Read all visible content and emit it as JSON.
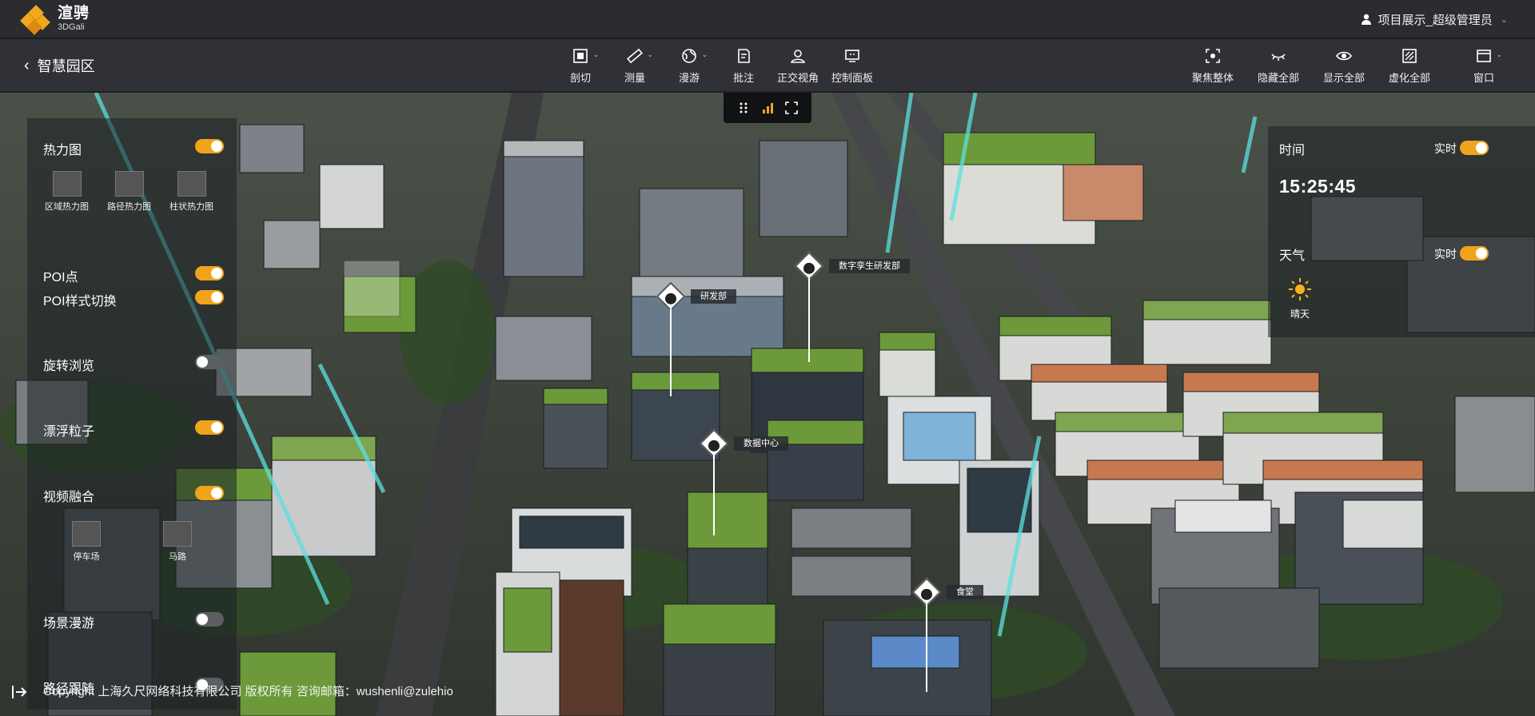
{
  "app": {
    "name": "渲骋",
    "sub": "3DGali"
  },
  "user": {
    "label": "项目展示_超级管理员"
  },
  "page": {
    "title": "智慧园区"
  },
  "tools": [
    {
      "id": "cut",
      "label": "剖切",
      "icon": "section-cut-icon",
      "dropdown": true
    },
    {
      "id": "measure",
      "label": "测量",
      "icon": "ruler-icon",
      "dropdown": true
    },
    {
      "id": "roam",
      "label": "漫游",
      "icon": "globe-icon",
      "dropdown": true
    },
    {
      "id": "annotate",
      "label": "批注",
      "icon": "annotate-icon",
      "dropdown": false
    },
    {
      "id": "ortho",
      "label": "正交视角",
      "icon": "ortho-view-icon",
      "dropdown": false
    },
    {
      "id": "panel",
      "label": "控制面板",
      "icon": "control-panel-icon",
      "dropdown": false
    }
  ],
  "right_tools": [
    {
      "id": "focus",
      "label": "聚焦整体",
      "icon": "focus-icon"
    },
    {
      "id": "hide",
      "label": "隐藏全部",
      "icon": "eye-closed-icon"
    },
    {
      "id": "show",
      "label": "显示全部",
      "icon": "eye-icon"
    },
    {
      "id": "virtual",
      "label": "虚化全部",
      "icon": "blur-icon"
    }
  ],
  "window_tool": {
    "label": "窗口",
    "icon": "window-icon"
  },
  "left_panel": {
    "heatmap": {
      "label": "热力图",
      "on": true,
      "items": [
        {
          "label": "区域热力图"
        },
        {
          "label": "路径热力图"
        },
        {
          "label": "柱状热力图"
        }
      ]
    },
    "poi": {
      "label": "POI点",
      "on": true
    },
    "poi_style": {
      "label": "POI样式切换",
      "on": true
    },
    "rotate": {
      "label": "旋转浏览",
      "on": false
    },
    "particles": {
      "label": "漂浮粒子",
      "on": true
    },
    "video": {
      "label": "视频融合",
      "on": true,
      "items": [
        {
          "label": "停车场"
        },
        {
          "label": "马路"
        }
      ]
    },
    "scene_roam": {
      "label": "场景漫游",
      "on": false
    },
    "path_follow": {
      "label": "路径跟随",
      "on": false
    }
  },
  "right_panel": {
    "time_label": "时间",
    "time_realtime": "实时",
    "time_on": true,
    "clock": "15:25:45",
    "weather_label": "天气",
    "weather_realtime": "实时",
    "weather_on": true,
    "weather_state": "晴天"
  },
  "pois": [
    {
      "label": "研发部"
    },
    {
      "label": "数字孪生研发部"
    },
    {
      "label": "数据中心"
    },
    {
      "label": "食堂"
    }
  ],
  "footer": "Copyright 上海久尺网络科技有限公司 版权所有 咨询邮箱：wushenli@zulehio",
  "colors": {
    "accent": "#f0a41c",
    "toggle_off": "#5b5f63",
    "beam": "#5ce0e0"
  }
}
